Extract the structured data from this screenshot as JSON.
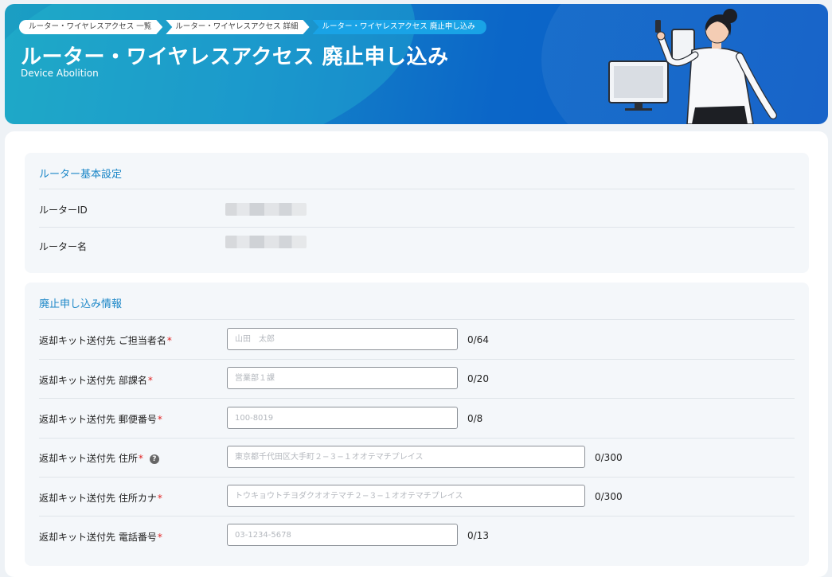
{
  "breadcrumbs": [
    "ルーター・ワイヤレスアクセス 一覧",
    "ルーター・ワイヤレスアクセス 詳細",
    "ルーター・ワイヤレスアクセス 廃止申し込み"
  ],
  "header": {
    "title": "ルーター・ワイヤレスアクセス 廃止申し込み",
    "subtitle": "Device Abolition"
  },
  "basic": {
    "section_title": "ルーター基本設定",
    "router_id_label": "ルーターID",
    "router_name_label": "ルーター名"
  },
  "form": {
    "section_title": "廃止申し込み情報",
    "required_mark": "*",
    "fields": [
      {
        "label": "返却キット送付先 ご担当者名",
        "placeholder": "山田　太郎",
        "count": "0/64"
      },
      {
        "label": "返却キット送付先 部課名",
        "placeholder": "営業部１課",
        "count": "0/20"
      },
      {
        "label": "返却キット送付先 郵便番号",
        "placeholder": "100-8019",
        "count": "0/8"
      },
      {
        "label": "返却キット送付先 住所",
        "placeholder": "東京都千代田区大手町２−３−１オオテマチプレイス",
        "count": "0/300"
      },
      {
        "label": "返却キット送付先 住所カナ",
        "placeholder": "トウキョウトチヨダクオオテマチ２−３−１オオテマチプレイス",
        "count": "0/300"
      },
      {
        "label": "返却キット送付先 電話番号",
        "placeholder": "03-1234-5678",
        "count": "0/13"
      }
    ],
    "help_icon": "?"
  },
  "colors": {
    "accent": "#1a86c7",
    "header_start": "#1b9fc3",
    "header_end": "#0a5bc6",
    "required": "#e02424"
  }
}
